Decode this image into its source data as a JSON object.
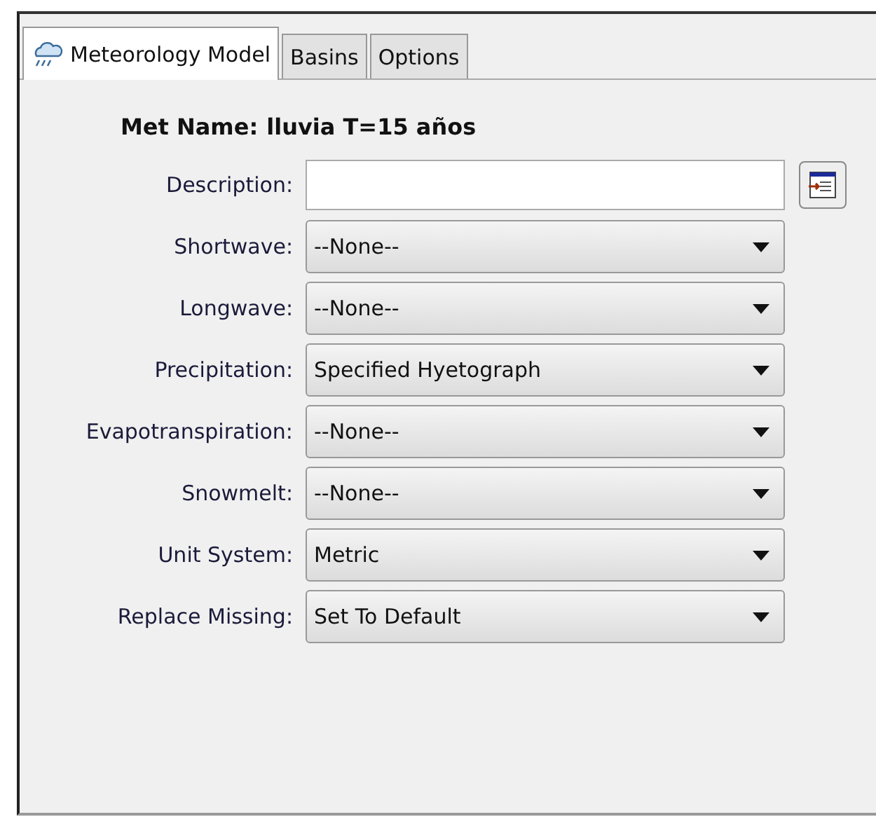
{
  "tabs": [
    {
      "label": "Meteorology Model",
      "selected": true,
      "icon": true
    },
    {
      "label": "Basins",
      "selected": false
    },
    {
      "label": "Options",
      "selected": false
    }
  ],
  "met_name": {
    "label": "Met Name:",
    "value": "lluvia T=15 años"
  },
  "fields": [
    {
      "kind": "text",
      "label": "Description:"
    },
    {
      "kind": "select",
      "label": "Shortwave:",
      "value": "--None--"
    },
    {
      "kind": "select",
      "label": "Longwave:",
      "value": "--None--"
    },
    {
      "kind": "select",
      "label": "Precipitation:",
      "value": "Specified Hyetograph"
    },
    {
      "kind": "select",
      "label": "Evapotranspiration:",
      "value": "--None--"
    },
    {
      "kind": "select",
      "label": "Snowmelt:",
      "value": "--None--"
    },
    {
      "kind": "select",
      "label": "Unit System:",
      "value": "Metric"
    },
    {
      "kind": "select",
      "label": "Replace Missing:",
      "value": "Set To Default"
    }
  ]
}
